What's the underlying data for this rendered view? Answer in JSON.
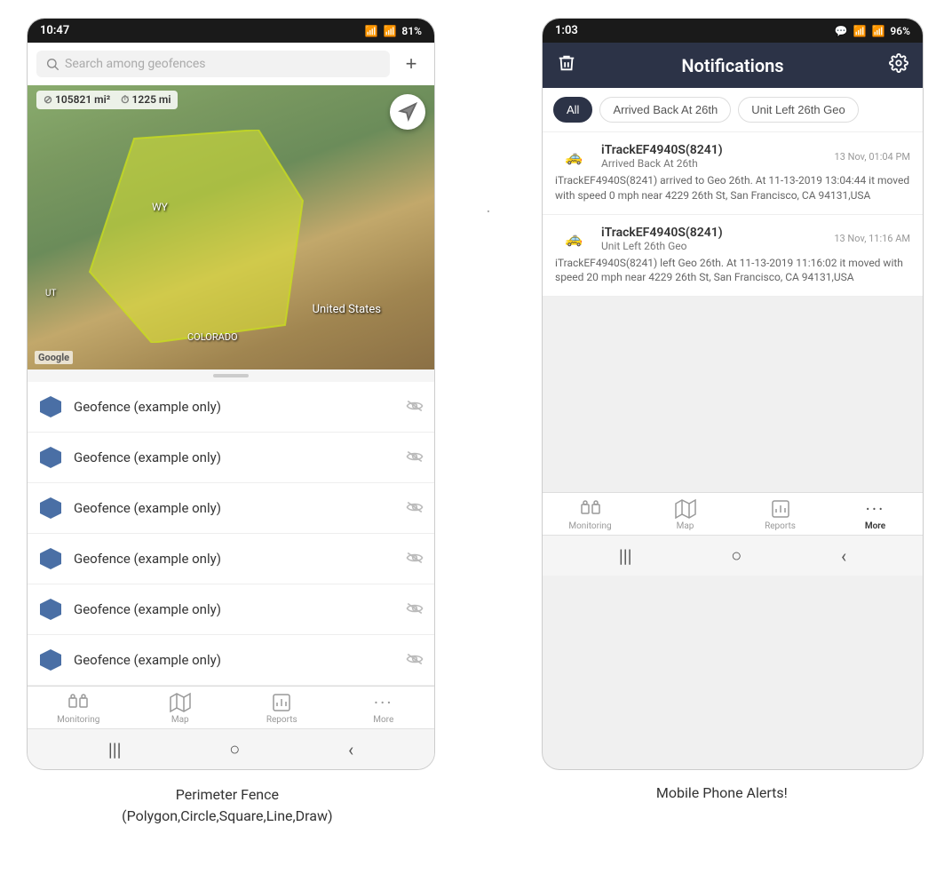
{
  "left_phone": {
    "status_bar": {
      "time": "10:47",
      "wifi": "WiFi",
      "signal": "Signal",
      "battery": "81%"
    },
    "search": {
      "placeholder": "Search among geofences"
    },
    "map": {
      "stats_area": "105821 mi²",
      "stats_dist": "1225 mi",
      "label_us": "United States",
      "label_wy": "WY",
      "label_co": "COLORADO",
      "label_ut": "UT",
      "google": "Google"
    },
    "geofence_items": [
      {
        "name": "Geofence (example only)"
      },
      {
        "name": "Geofence (example only)"
      },
      {
        "name": "Geofence (example only)"
      },
      {
        "name": "Geofence (example only)"
      },
      {
        "name": "Geofence (example only)"
      },
      {
        "name": "Geofence (example only)"
      }
    ],
    "nav": [
      {
        "label": "Monitoring",
        "icon": "🚌"
      },
      {
        "label": "Map",
        "icon": "🗺"
      },
      {
        "label": "Reports",
        "icon": "📊"
      },
      {
        "label": "More",
        "icon": "···"
      }
    ],
    "caption_line1": "Perimeter Fence",
    "caption_line2": "(Polygon,Circle,Square,Line,Draw)"
  },
  "right_phone": {
    "status_bar": {
      "time": "1:03",
      "battery": "96%"
    },
    "toolbar": {
      "title": "Notifications",
      "delete_icon": "🗑",
      "settings_icon": "⚙"
    },
    "filters": [
      {
        "label": "All",
        "active": true
      },
      {
        "label": "Arrived Back At 26th",
        "active": false
      },
      {
        "label": "Unit Left 26th Geo",
        "active": false
      }
    ],
    "notifications": [
      {
        "device": "iTrackEF4940S(8241)",
        "event": "Arrived Back At 26th",
        "time": "13 Nov, 01:04 PM",
        "body": "iTrackEF4940S(8241) arrived to Geo 26th.    At 11-13-2019 13:04:44 it moved with speed 0 mph near 4229 26th St, San Francisco, CA 94131,USA"
      },
      {
        "device": "iTrackEF4940S(8241)",
        "event": "Unit Left 26th Geo",
        "time": "13 Nov, 11:16 AM",
        "body": "iTrackEF4940S(8241) left Geo 26th.    At 11-13-2019 11:16:02 it moved with speed 20 mph near 4229 26th St, San Francisco, CA 94131,USA"
      }
    ],
    "nav": [
      {
        "label": "Monitoring",
        "icon": "🚌"
      },
      {
        "label": "Map",
        "icon": "🗺"
      },
      {
        "label": "Reports",
        "icon": "📊"
      },
      {
        "label": "More",
        "icon": "···"
      }
    ],
    "caption": "Mobile Phone Alerts!"
  },
  "dot": "."
}
